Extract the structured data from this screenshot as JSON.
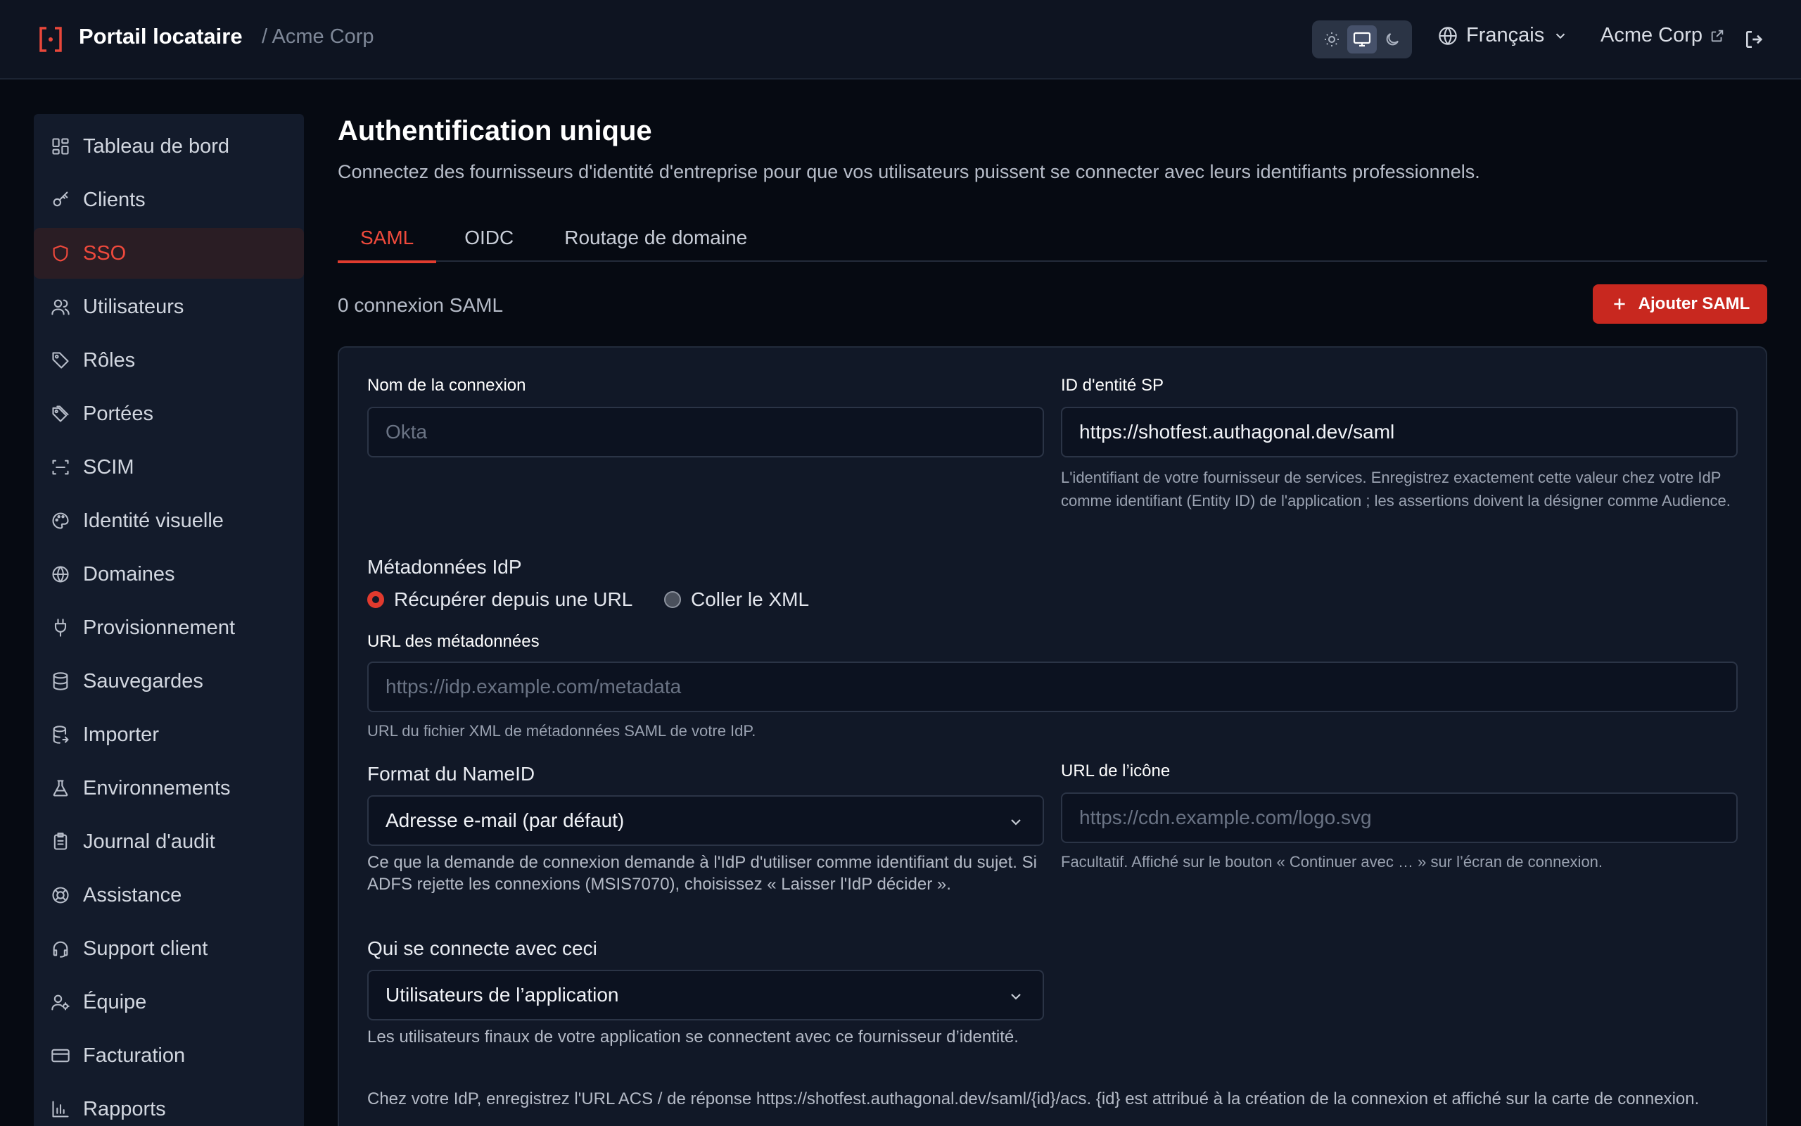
{
  "header": {
    "title": "Portail locataire",
    "tenant": "/ Acme Corp",
    "language": "Français",
    "org_link": "Acme Corp",
    "theme_options": [
      "sun-icon",
      "monitor-icon",
      "moon-icon"
    ],
    "theme_active": "monitor-icon"
  },
  "sidebar": {
    "items": [
      {
        "label": "Tableau de bord",
        "icon": "dashboard-icon"
      },
      {
        "label": "Clients",
        "icon": "key-icon"
      },
      {
        "label": "SSO",
        "icon": "shield-icon",
        "active": true
      },
      {
        "label": "Utilisateurs",
        "icon": "users-icon"
      },
      {
        "label": "Rôles",
        "icon": "tag-icon"
      },
      {
        "label": "Portées",
        "icon": "tags-icon"
      },
      {
        "label": "SCIM",
        "icon": "scan-icon"
      },
      {
        "label": "Identité visuelle",
        "icon": "palette-icon"
      },
      {
        "label": "Domaines",
        "icon": "globe-icon"
      },
      {
        "label": "Provisionnement",
        "icon": "plug-icon"
      },
      {
        "label": "Sauvegardes",
        "icon": "database-icon"
      },
      {
        "label": "Importer",
        "icon": "database-import-icon"
      },
      {
        "label": "Environnements",
        "icon": "flask-icon"
      },
      {
        "label": "Journal d'audit",
        "icon": "clipboard-icon"
      },
      {
        "label": "Assistance",
        "icon": "lifebuoy-icon"
      },
      {
        "label": "Support client",
        "icon": "headset-icon"
      },
      {
        "label": "Équipe",
        "icon": "user-gear-icon"
      },
      {
        "label": "Facturation",
        "icon": "credit-card-icon"
      },
      {
        "label": "Rapports",
        "icon": "bar-chart-icon"
      }
    ]
  },
  "main": {
    "title": "Authentification unique",
    "subtitle": "Connectez des fournisseurs d'identité d'entreprise pour que vos utilisateurs puissent se connecter avec leurs identifiants professionnels.",
    "tabs": [
      {
        "label": "SAML",
        "active": true
      },
      {
        "label": "OIDC"
      },
      {
        "label": "Routage de domaine"
      }
    ],
    "count": "0 connexion SAML",
    "add_button": "Ajouter SAML"
  },
  "form": {
    "connection_name": {
      "label": "Nom de la connexion",
      "placeholder": "Okta",
      "value": ""
    },
    "sp_entity_id": {
      "label": "ID d'entité SP",
      "value": "https://shotfest.authagonal.dev/saml",
      "help": "L'identifiant de votre fournisseur de services. Enregistrez exactement cette valeur chez votre IdP comme identifiant (Entity ID) de l'application ; les assertions doivent la désigner comme Audience."
    },
    "metadata": {
      "label": "Métadonnées IdP",
      "option_url": "Récupérer depuis une URL",
      "option_xml": "Coller le XML",
      "selected": "url"
    },
    "metadata_url": {
      "label": "URL des métadonnées",
      "placeholder": "https://idp.example.com/metadata",
      "help": "URL du fichier XML de métadonnées SAML de votre IdP."
    },
    "nameid_format": {
      "label": "Format du NameID",
      "value": "Adresse e-mail (par défaut)",
      "help": "Ce que la demande de connexion demande à l'IdP d'utiliser comme identifiant du sujet. Si ADFS rejette les connexions (MSIS7070), choisissez « Laisser l'IdP décider »."
    },
    "icon_url": {
      "label": "URL de l’icône",
      "placeholder": "https://cdn.example.com/logo.svg",
      "help": "Facultatif. Affiché sur le bouton « Continuer avec … » sur l’écran de connexion."
    },
    "audience": {
      "label": "Qui se connecte avec ceci",
      "value": "Utilisateurs de l’application",
      "help": "Les utilisateurs finaux de votre application se connectent avec ce fournisseur d’identité."
    },
    "acs_note": "Chez votre IdP, enregistrez l'URL ACS / de réponse https://shotfest.authagonal.dev/saml/{id}/acs. {id} est attribué à la création de la connexion et affiché sur la carte de connexion."
  },
  "colors": {
    "accent": "#e03c2f",
    "background": "#060a12",
    "panel": "#111827",
    "sidebar": "#131b2b"
  }
}
